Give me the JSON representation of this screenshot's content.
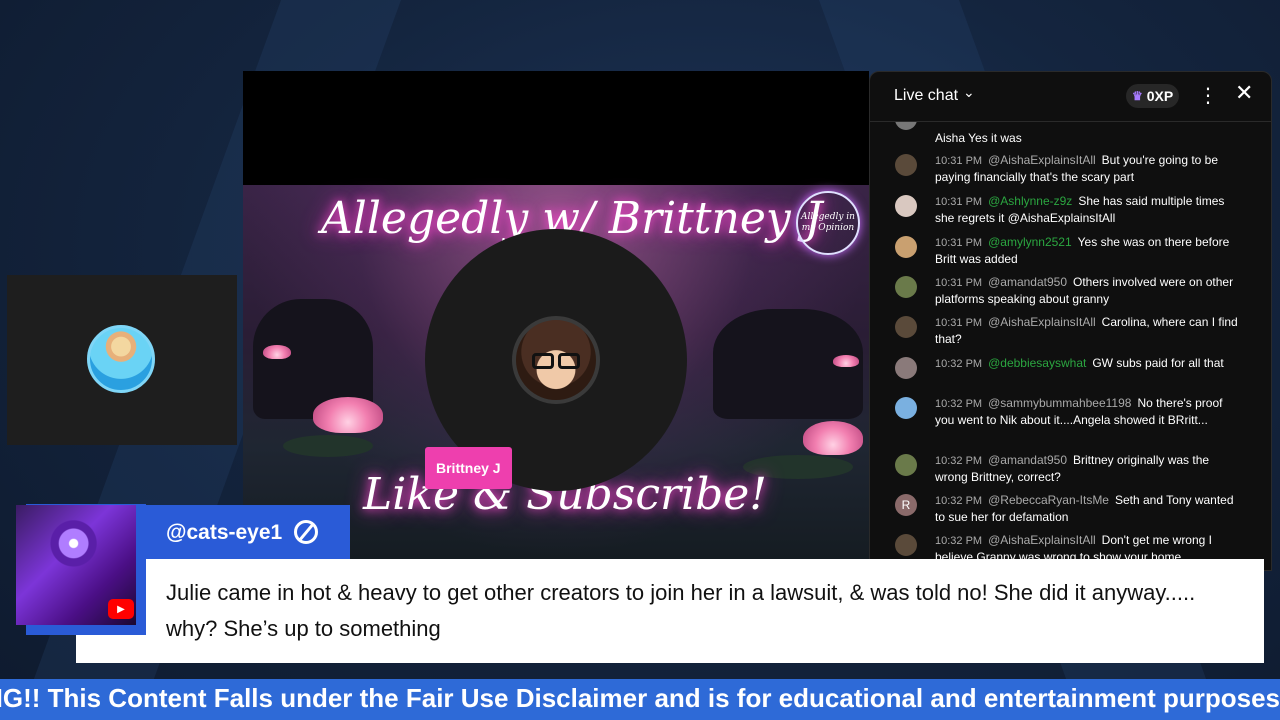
{
  "stream": {
    "show_title": "Allegedly w/ Brittney J",
    "badge_text": "Allegedly in my Opinion",
    "subscribe_text": "Like & Subscribe!",
    "guest_name": "Brittney J"
  },
  "chat": {
    "title": "Live chat",
    "xp": "0XP",
    "messages": [
      {
        "time": "",
        "author": "",
        "text": "Aisha Yes it was",
        "avatar_color": "#777"
      },
      {
        "time": "10:31 PM",
        "author": "@AishaExplainsItAll",
        "text": "But you're going to be paying financially that's the scary part",
        "avatar_color": "#5a4a3a"
      },
      {
        "time": "10:31 PM",
        "author": "@Ashlynne-z9z",
        "text": "She has said multiple times she regrets it @AishaExplainsItAll",
        "avatar_color": "#d9c8c0",
        "member": true
      },
      {
        "time": "10:31 PM",
        "author": "@amylynn2521",
        "text": "Yes she was on there before Britt was added",
        "avatar_color": "#c9a070",
        "member": true
      },
      {
        "time": "10:31 PM",
        "author": "@amandat950",
        "text": "Others involved were on other platforms speaking about granny",
        "avatar_color": "#6a7a4a"
      },
      {
        "time": "10:31 PM",
        "author": "@AishaExplainsItAll",
        "text": "Carolina, where can I find that?",
        "avatar_color": "#5a4a3a"
      },
      {
        "time": "10:32 PM",
        "author": "@debbiesayswhat",
        "text": "GW subs paid for all that",
        "avatar_color": "#8a7a7a",
        "member": true
      },
      {
        "time": "10:32 PM",
        "author": "@sammybummahbee1198",
        "text": "No there's proof you went to Nik about it....Angela showed it BRritt...",
        "avatar_color": "#7ab0e0"
      },
      {
        "time": "10:32 PM",
        "author": "@amandat950",
        "text": "Brittney originally was the wrong Brittney, correct?",
        "avatar_color": "#6a7a4a"
      },
      {
        "time": "10:32 PM",
        "author": "@RebeccaRyan-ItsMe",
        "text": "Seth and Tony wanted to sue her for defamation",
        "avatar_color": "#8a6a6a",
        "avatar_letter": "R"
      },
      {
        "time": "10:32 PM",
        "author": "@AishaExplainsItAll",
        "text": "Don't get me wrong I believe Granny was wrong to show your home",
        "avatar_color": "#5a4a3a"
      }
    ]
  },
  "comment": {
    "author": "@cats-eye1",
    "text": "Julie came in hot & heavy to get other creators to join her in a lawsuit, & was told no! She did it anyway..... why? She’s up to something"
  },
  "ticker": {
    "text": "ERING!! This Content Falls under the Fair Use Disclaimer and is for educational and entertainment purposes"
  },
  "colors": {
    "accent_blue": "#2a5bd7",
    "ticker_blue": "#2e6ad7",
    "guest_pink": "#ee3fae",
    "member_green": "#2ba640"
  },
  "icons": [
    "chevron-down-icon",
    "crown-icon",
    "more-vert-icon",
    "close-icon",
    "verify-icon",
    "youtube-icon"
  ]
}
